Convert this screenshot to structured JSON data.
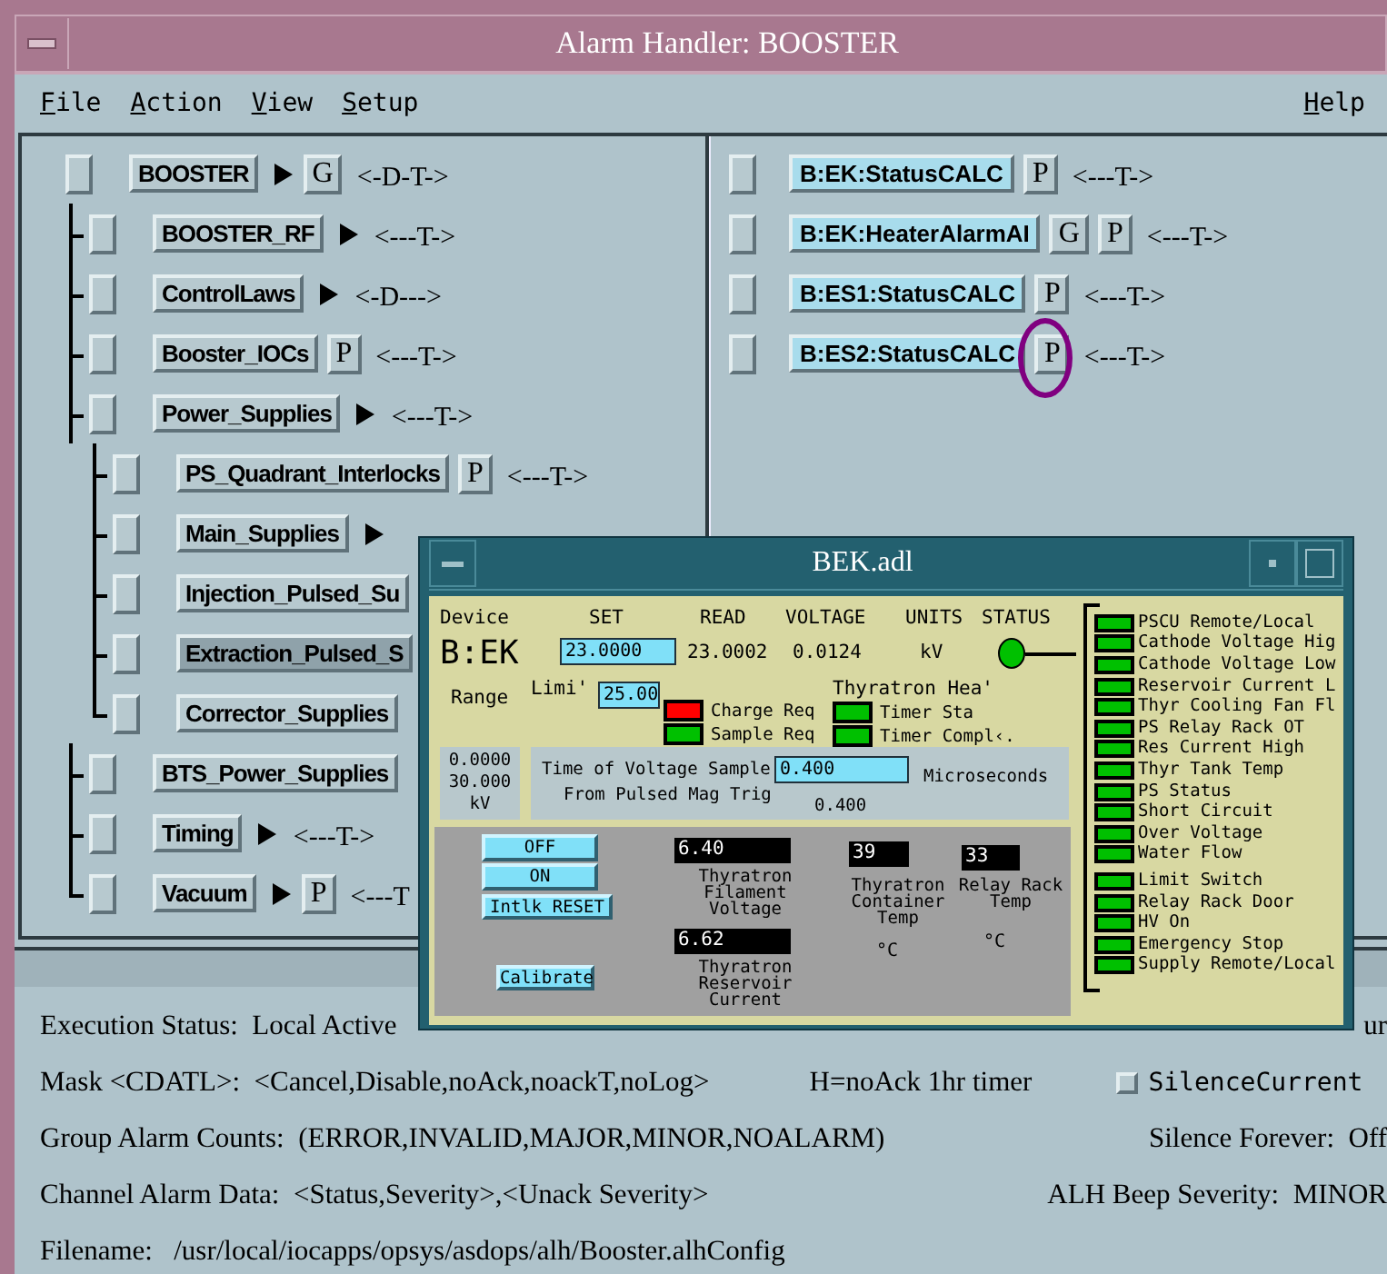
{
  "window": {
    "title": "Alarm Handler: BOOSTER"
  },
  "menu": [
    {
      "label": "File"
    },
    {
      "label": "Action"
    },
    {
      "label": "View"
    },
    {
      "label": "Setup"
    }
  ],
  "help_menu": {
    "label": "Help"
  },
  "tree": [
    {
      "label": "BOOSTER",
      "arrow": true,
      "buttons": [
        "G"
      ],
      "mask": "<-D-T->",
      "selected": false,
      "children": [
        {
          "label": "BOOSTER_RF",
          "arrow": true,
          "mask": "<---T->",
          "selected": false
        },
        {
          "label": "ControlLaws",
          "arrow": true,
          "mask": "<-D--->",
          "selected": false
        },
        {
          "label": "Booster_IOCs",
          "arrow": false,
          "buttons": [
            "P"
          ],
          "mask": "<---T->",
          "selected": false
        },
        {
          "label": "Power_Supplies",
          "arrow": true,
          "mask": "<---T->",
          "selected": false,
          "children": [
            {
              "label": "PS_Quadrant_Interlocks",
              "arrow": false,
              "buttons": [
                "P"
              ],
              "mask": "<---T->",
              "selected": false
            },
            {
              "label": "Main_Supplies",
              "arrow": true,
              "selected": false
            },
            {
              "label": "Injection_Pulsed_Su",
              "arrow": false,
              "selected": false
            },
            {
              "label": "Extraction_Pulsed_S",
              "arrow": false,
              "selected": true
            },
            {
              "label": "Corrector_Supplies",
              "arrow": false,
              "selected": false
            }
          ]
        },
        {
          "label": "BTS_Power_Supplies",
          "arrow": false,
          "selected": false
        },
        {
          "label": "Timing",
          "arrow": true,
          "mask": "<---T->",
          "selected": false
        },
        {
          "label": "Vacuum",
          "arrow": true,
          "buttons": [
            "P"
          ],
          "mask": "<---T",
          "selected": false
        }
      ]
    }
  ],
  "channels": [
    {
      "label": "B:EK:StatusCALC",
      "buttons": [
        {
          "label": "P",
          "circled": false
        }
      ],
      "mask": "<---T->"
    },
    {
      "label": "B:EK:HeaterAlarmAI",
      "buttons": [
        {
          "label": "G",
          "circled": false
        },
        {
          "label": "P",
          "circled": false
        }
      ],
      "mask": "<---T->"
    },
    {
      "label": "B:ES1:StatusCALC",
      "buttons": [
        {
          "label": "P",
          "circled": false
        }
      ],
      "mask": "<---T->"
    },
    {
      "label": "B:ES2:StatusCALC",
      "buttons": [
        {
          "label": "P",
          "circled": true
        }
      ],
      "mask": "<---T->"
    }
  ],
  "status": {
    "execution": {
      "label": "Execution Status:",
      "value": "Local Active",
      "fragment": "ur"
    },
    "mask": {
      "label": "Mask <CDATL>:",
      "value": "<Cancel,Disable,noAck,noackT,noLog>",
      "note": "H=noAck 1hr timer"
    },
    "silence_current": {
      "label": "SilenceCurrent",
      "checked": false
    },
    "group_counts": {
      "label": "Group Alarm Counts:",
      "value": "(ERROR,INVALID,MAJOR,MINOR,NOALARM)"
    },
    "silence_forever": {
      "label": "Silence Forever:",
      "value": "Off"
    },
    "channel_data": {
      "label": "Channel Alarm Data:",
      "value": "<Status,Severity>,<Unack Severity>"
    },
    "beep": {
      "label": "ALH Beep Severity:",
      "value": "MINOR"
    },
    "filename": {
      "label": "Filename:",
      "value": "/usr/local/iocapps/opsys/asdops/alh/Booster.alhConfig"
    }
  },
  "popup": {
    "title": "BEK.adl",
    "device_label": "Device",
    "device": "B:EK",
    "columns": [
      "SET",
      "READ",
      "VOLTAGE",
      "UNITS",
      "STATUS"
    ],
    "set_value": "23.0000",
    "read": "23.0002",
    "voltage": "0.0124",
    "units": "kV",
    "range_label": "Range",
    "limit_label": "Limi'",
    "limit_value": "25.00",
    "requests": [
      {
        "label": "Charge Req",
        "color": "#ff0000"
      },
      {
        "label": "Sample Req",
        "color": "#00c000"
      }
    ],
    "heater_title": "Thyratron Hea'",
    "timers": [
      {
        "label": "Timer Sta",
        "color": "#00c000"
      },
      {
        "label": "Timer Compl‹.",
        "color": "#00c000"
      }
    ],
    "range_values": [
      "0.0000",
      "30.000",
      "kV"
    ],
    "sample_label": "Time of Voltage Sample",
    "sample_label_2": "From Pulsed Mag Trig",
    "sample_value": "0.400",
    "sample_units": "Microseconds",
    "sample_read": "0.400",
    "buttons": [
      "OFF",
      "ON",
      "Intlk RESET",
      "Calibrate"
    ],
    "readouts": [
      {
        "value": "6.40",
        "label": "Thyratron Filament Voltage"
      },
      {
        "value": "6.62",
        "label": "Thyratron Reservoir Current"
      },
      {
        "value": "39",
        "label": "Thyratron Container Temp",
        "unit": "°C"
      },
      {
        "value": "33",
        "label": "Relay Rack Temp",
        "unit": "°C"
      }
    ],
    "interlocks": [
      {
        "label": "PSCU Remote/Local",
        "color": "#00c000"
      },
      {
        "label": "Cathode Voltage Hig",
        "color": "#00c000"
      },
      {
        "label": "Cathode Voltage Low",
        "color": "#00c000"
      },
      {
        "label": "Reservoir Current L",
        "color": "#00c000"
      },
      {
        "label": "Thyr Cooling Fan Fl",
        "color": "#00c000"
      },
      {
        "label": "PS Relay Rack OT",
        "color": "#00c000"
      },
      {
        "label": "Res Current High",
        "color": "#00c000"
      },
      {
        "label": "Thyr Tank Temp",
        "color": "#00c000"
      },
      {
        "label": "PS Status",
        "color": "#00c000"
      },
      {
        "label": "Short Circuit",
        "color": "#00c000"
      },
      {
        "label": "Over Voltage",
        "color": "#00c000"
      },
      {
        "label": "Water Flow",
        "color": "#00c000"
      },
      {
        "label": "Limit Switch",
        "color": "#00c000"
      },
      {
        "label": "Relay Rack Door",
        "color": "#00c000"
      },
      {
        "label": "HV On",
        "color": "#00c000"
      },
      {
        "label": "Emergency Stop",
        "color": "#00c000"
      },
      {
        "label": "Supply Remote/Local",
        "color": "#00c000"
      }
    ]
  }
}
